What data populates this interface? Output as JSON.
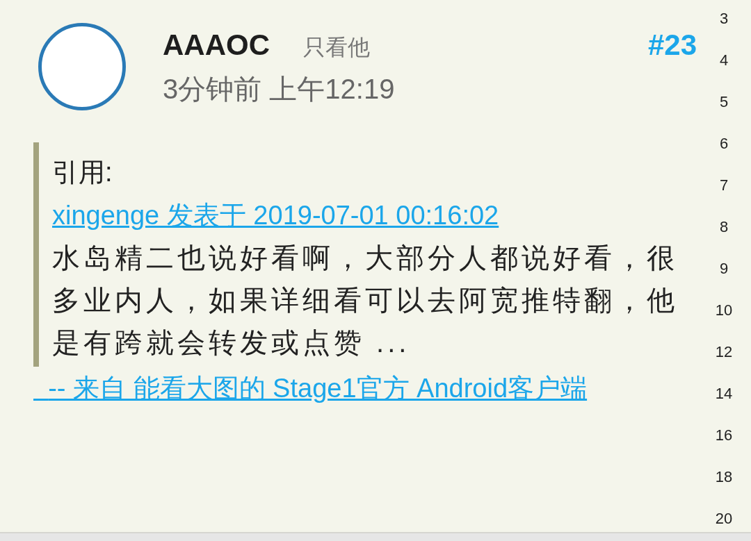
{
  "post": {
    "author": "AAAOC",
    "only_this_user": "只看他",
    "floor": "#23",
    "time": "3分钟前 上午12:19",
    "quote": {
      "label": "引用:",
      "source": "xingenge 发表于 2019-07-01 00:16:02",
      "text": "水岛精二也说好看啊，大部分人都说好看，很多业内人，如果详细看可以去阿宽推特翻，他是有跨就会转发或点赞 ..."
    },
    "signature": "  -- 来自 能看大图的 Stage1官方 Android客户端"
  },
  "page_index": [
    "3",
    "4",
    "5",
    "6",
    "7",
    "8",
    "9",
    "10",
    "12",
    "14",
    "16",
    "18",
    "20"
  ]
}
